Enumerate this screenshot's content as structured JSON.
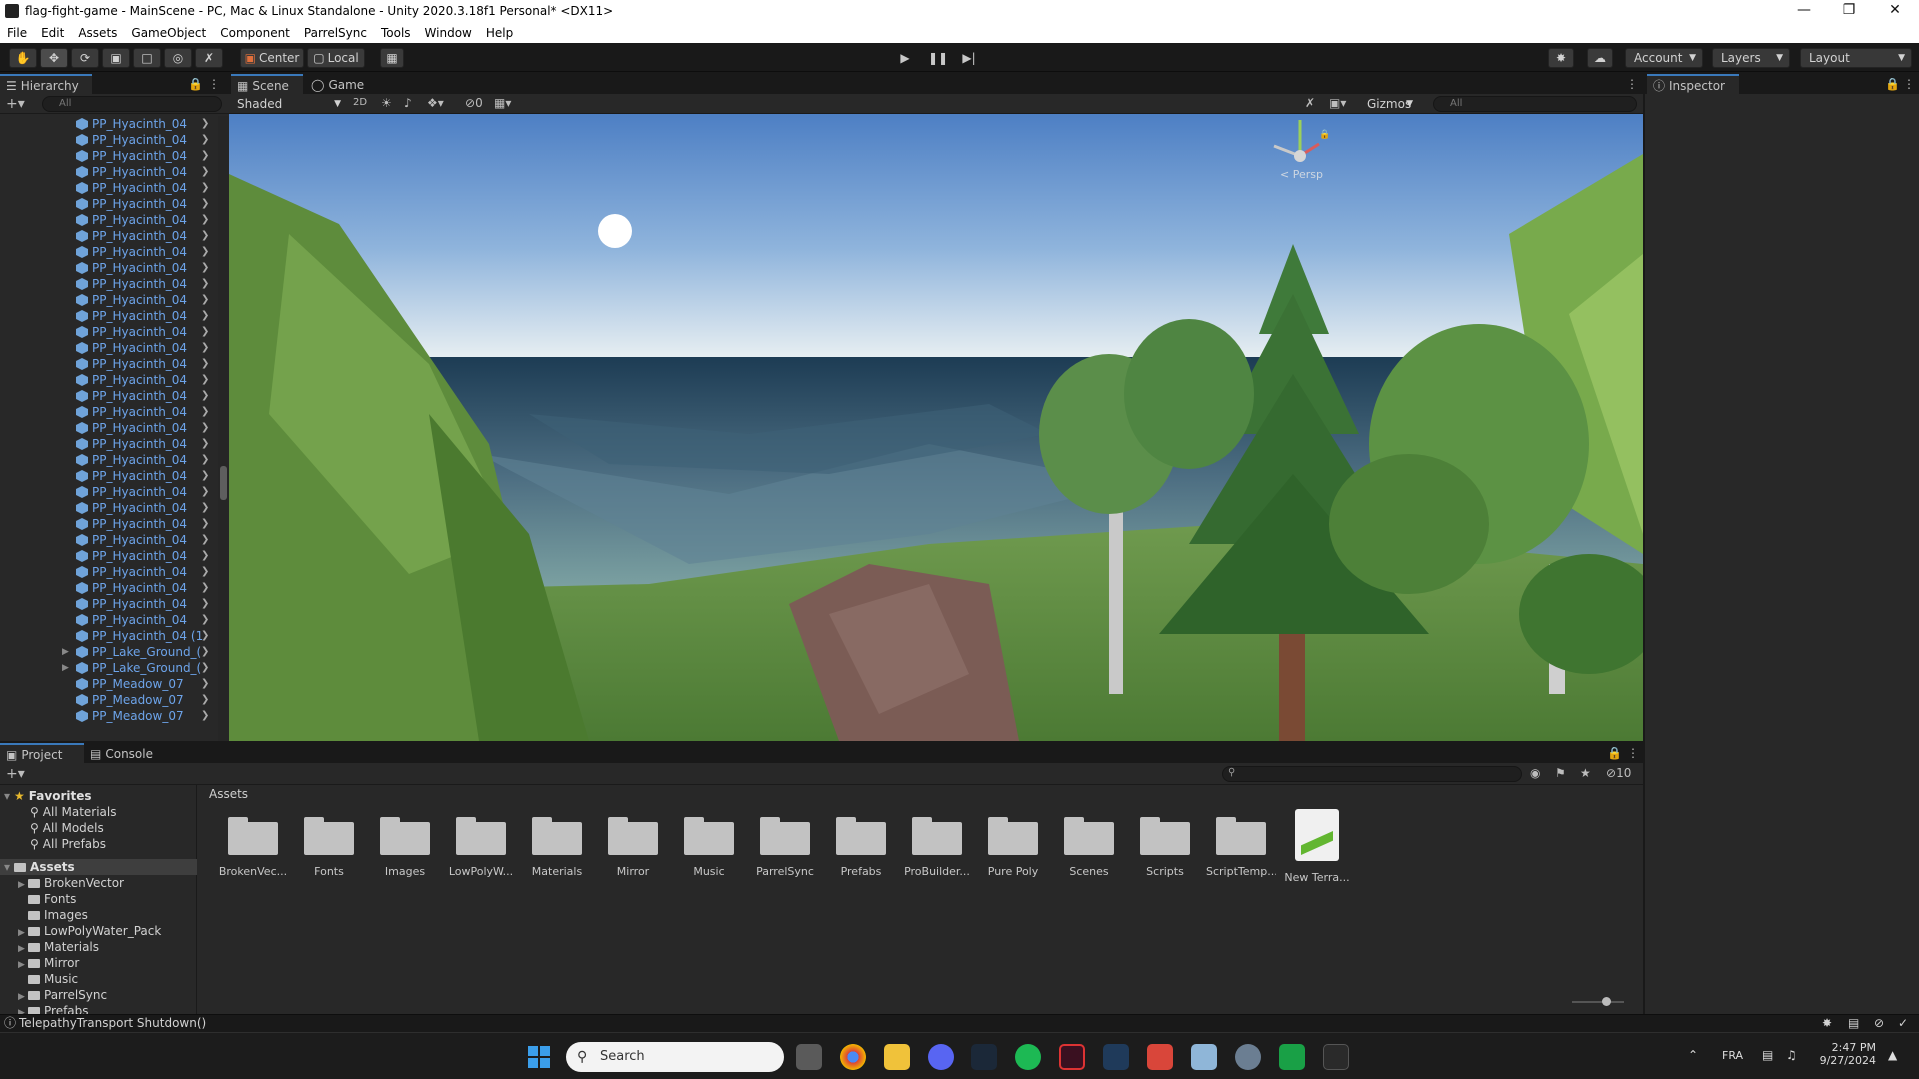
{
  "window": {
    "title": "flag-fight-game - MainScene - PC, Mac & Linux Standalone - Unity 2020.3.18f1 Personal* <DX11>"
  },
  "menu": [
    "File",
    "Edit",
    "Assets",
    "GameObject",
    "Component",
    "ParrelSync",
    "Tools",
    "Window",
    "Help"
  ],
  "toolbar": {
    "center_label": "Center",
    "local_label": "Local",
    "account_label": "Account",
    "layers_label": "Layers",
    "layout_label": "Layout"
  },
  "hierarchy": {
    "tab": "Hierarchy",
    "search_placeholder": "All",
    "items": [
      "PP_Hyacinth_04",
      "PP_Hyacinth_04",
      "PP_Hyacinth_04",
      "PP_Hyacinth_04",
      "PP_Hyacinth_04",
      "PP_Hyacinth_04",
      "PP_Hyacinth_04",
      "PP_Hyacinth_04",
      "PP_Hyacinth_04",
      "PP_Hyacinth_04",
      "PP_Hyacinth_04",
      "PP_Hyacinth_04",
      "PP_Hyacinth_04",
      "PP_Hyacinth_04",
      "PP_Hyacinth_04",
      "PP_Hyacinth_04",
      "PP_Hyacinth_04",
      "PP_Hyacinth_04",
      "PP_Hyacinth_04",
      "PP_Hyacinth_04",
      "PP_Hyacinth_04",
      "PP_Hyacinth_04",
      "PP_Hyacinth_04",
      "PP_Hyacinth_04",
      "PP_Hyacinth_04",
      "PP_Hyacinth_04",
      "PP_Hyacinth_04",
      "PP_Hyacinth_04",
      "PP_Hyacinth_04",
      "PP_Hyacinth_04",
      "PP_Hyacinth_04",
      "PP_Hyacinth_04",
      "PP_Hyacinth_04 (1",
      "PP_Lake_Ground_(",
      "PP_Lake_Ground_(",
      "PP_Meadow_07",
      "PP_Meadow_07",
      "PP_Meadow_07"
    ]
  },
  "scene": {
    "tab_scene": "Scene",
    "tab_game": "Game",
    "shading": "Shaded",
    "mode_2d": "2D",
    "hidden_count": "0",
    "gizmos": "Gizmos",
    "search_placeholder": "All",
    "persp_label": "< Persp"
  },
  "inspector": {
    "tab": "Inspector"
  },
  "project": {
    "tab_project": "Project",
    "tab_console": "Console",
    "favorites_label": "Favorites",
    "favorites": [
      "All Materials",
      "All Models",
      "All Prefabs"
    ],
    "assets_label": "Assets",
    "folders": [
      "BrokenVector",
      "Fonts",
      "Images",
      "LowPolyWater_Pack",
      "Materials",
      "Mirror",
      "Music",
      "ParrelSync",
      "Prefabs"
    ],
    "breadcrumb": "Assets",
    "hidden_count": "10",
    "grid": [
      "BrokenVec...",
      "Fonts",
      "Images",
      "LowPolyW...",
      "Materials",
      "Mirror",
      "Music",
      "ParrelSync",
      "Prefabs",
      "ProBuilder...",
      "Pure Poly",
      "Scenes",
      "Scripts",
      "ScriptTemp...",
      "New Terra..."
    ]
  },
  "status": {
    "message": "TelepathyTransport Shutdown()"
  },
  "taskbar": {
    "search_placeholder": "Search",
    "lang": "FRA",
    "time": "2:47 PM",
    "date": "9/27/2024"
  }
}
